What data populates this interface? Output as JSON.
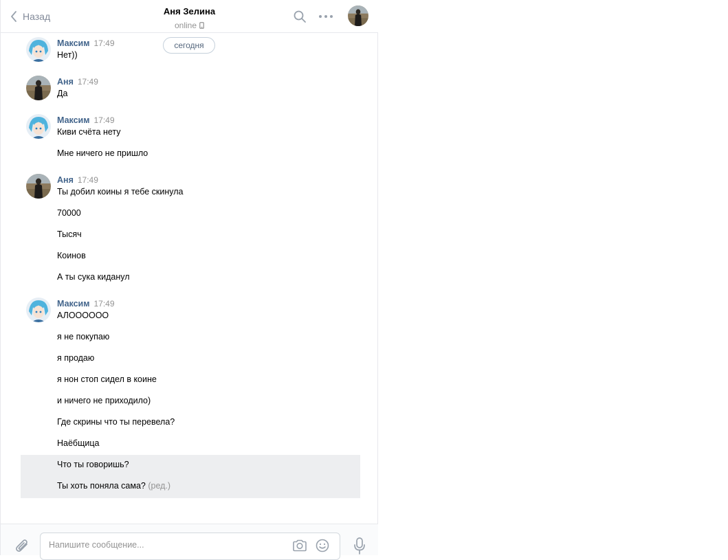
{
  "header": {
    "back_label": "Назад",
    "peer_name": "Аня Зелина",
    "peer_status": "online"
  },
  "date_divider": "сегодня",
  "groups": [
    {
      "author": "Максим",
      "time": "17:49",
      "avatar": "anime-avatar",
      "messages": [
        "Нет))"
      ]
    },
    {
      "author": "Аня",
      "time": "17:49",
      "avatar": "photo-avatar",
      "messages": [
        "Да"
      ]
    },
    {
      "author": "Максим",
      "time": "17:49",
      "avatar": "anime-avatar",
      "messages": [
        "Киви счёта нету",
        "Мне ничего не пришло"
      ]
    },
    {
      "author": "Аня",
      "time": "17:49",
      "avatar": "photo-avatar",
      "messages": [
        "Ты добил коины я тебе скинула",
        "70000",
        "Тысяч",
        "Коинов",
        "А ты сука киданул"
      ]
    },
    {
      "author": "Максим",
      "time": "17:49",
      "avatar": "anime-avatar",
      "messages": [
        "АЛОООООО",
        "я не покупаю",
        "я продаю",
        "я нон стоп сидел в коине",
        "и ничего не приходило)",
        "Где скрины что ты перевела?",
        "Наёбщица",
        "Что ты говоришь?",
        "Ты хоть поняла сама?"
      ]
    }
  ],
  "edited_label": "(ред.)",
  "composer": {
    "placeholder": "Напишите сообщение...",
    "value": ""
  },
  "icons": {
    "back": "chevron-left-icon",
    "search": "search-icon",
    "more": "more-dots-icon",
    "phone": "mobile-phone-icon",
    "attach": "paperclip-icon",
    "camera": "camera-icon",
    "emoji": "emoji-icon",
    "mic": "microphone-icon"
  },
  "colors": {
    "author": "#42648b",
    "muted": "#939393",
    "selected_bg": "#edeef0",
    "border": "#e7e8ec"
  }
}
